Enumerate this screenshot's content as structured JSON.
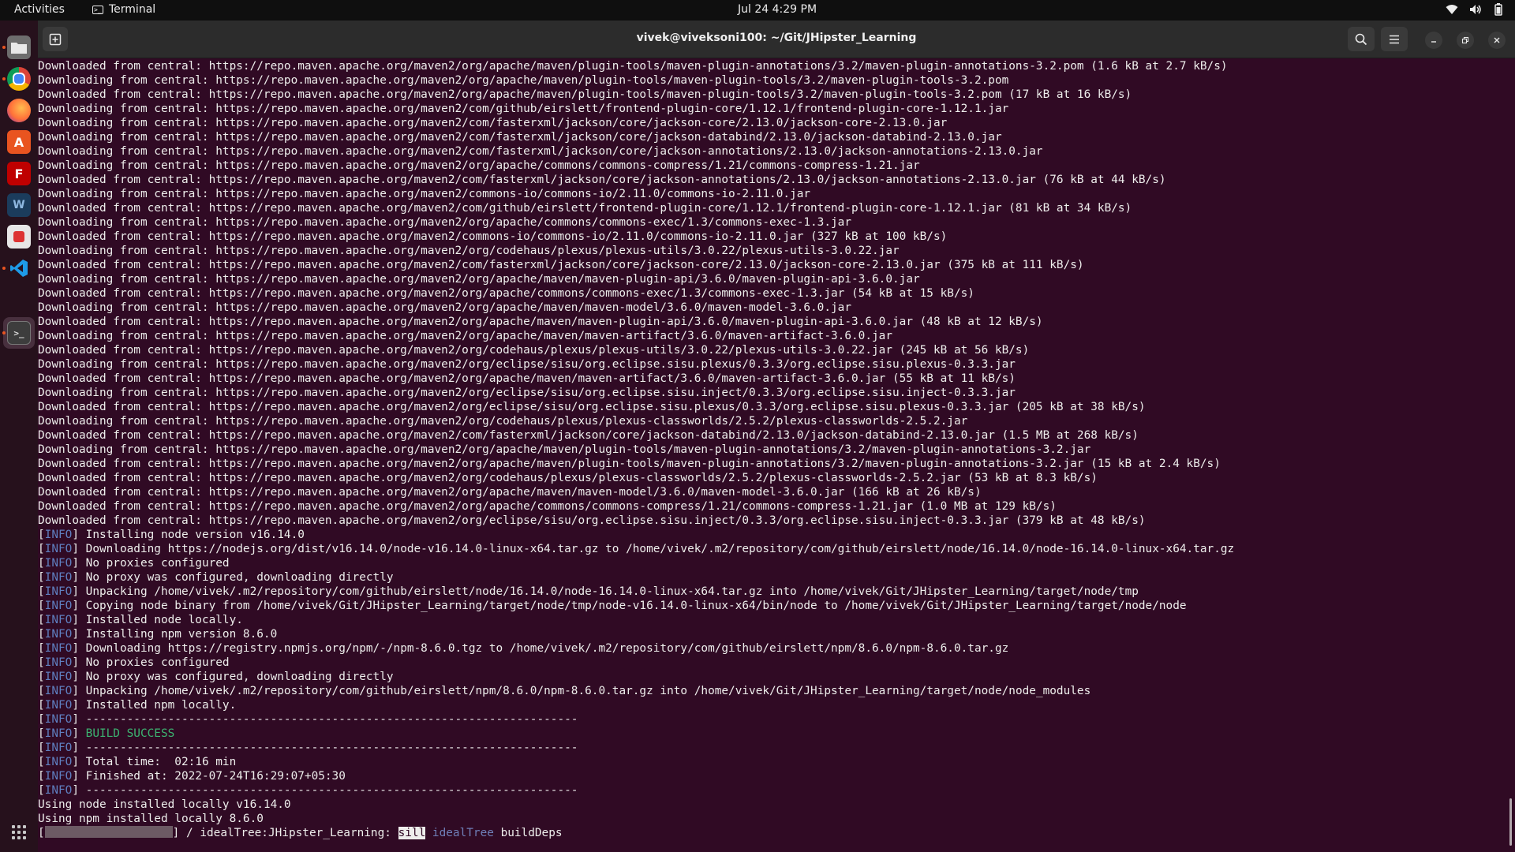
{
  "topbar": {
    "activities": "Activities",
    "app_name": "Terminal",
    "clock": "Jul 24  4:29 PM",
    "tray_icons": [
      "wifi-icon",
      "volume-icon",
      "battery-icon"
    ]
  },
  "dock": {
    "items": [
      "files-icon",
      "chrome-icon",
      "firefox-icon",
      "software-center-icon",
      "filezilla-icon",
      "mysql-workbench-icon",
      "screenshot-tool-icon",
      "vscode-icon",
      "terminal-icon"
    ],
    "show_apps": "show-applications-icon"
  },
  "window": {
    "title": "vivek@viveksoni100: ~/Git/JHipster_Learning",
    "buttons": [
      "new-tab-icon",
      "search-icon",
      "menu-icon",
      "minimize-icon",
      "maximize-icon",
      "close-icon"
    ]
  },
  "terminal": {
    "plain_lines": [
      "Downloaded from central: https://repo.maven.apache.org/maven2/org/apache/maven/plugin-tools/maven-plugin-annotations/3.2/maven-plugin-annotations-3.2.pom (1.6 kB at 2.7 kB/s)",
      "Downloading from central: https://repo.maven.apache.org/maven2/org/apache/maven/plugin-tools/maven-plugin-tools/3.2/maven-plugin-tools-3.2.pom",
      "Downloaded from central: https://repo.maven.apache.org/maven2/org/apache/maven/plugin-tools/maven-plugin-tools/3.2/maven-plugin-tools-3.2.pom (17 kB at 16 kB/s)",
      "Downloading from central: https://repo.maven.apache.org/maven2/com/github/eirslett/frontend-plugin-core/1.12.1/frontend-plugin-core-1.12.1.jar",
      "Downloading from central: https://repo.maven.apache.org/maven2/com/fasterxml/jackson/core/jackson-core/2.13.0/jackson-core-2.13.0.jar",
      "Downloading from central: https://repo.maven.apache.org/maven2/com/fasterxml/jackson/core/jackson-databind/2.13.0/jackson-databind-2.13.0.jar",
      "Downloading from central: https://repo.maven.apache.org/maven2/com/fasterxml/jackson/core/jackson-annotations/2.13.0/jackson-annotations-2.13.0.jar",
      "Downloading from central: https://repo.maven.apache.org/maven2/org/apache/commons/commons-compress/1.21/commons-compress-1.21.jar",
      "Downloaded from central: https://repo.maven.apache.org/maven2/com/fasterxml/jackson/core/jackson-annotations/2.13.0/jackson-annotations-2.13.0.jar (76 kB at 44 kB/s)",
      "Downloading from central: https://repo.maven.apache.org/maven2/commons-io/commons-io/2.11.0/commons-io-2.11.0.jar",
      "Downloaded from central: https://repo.maven.apache.org/maven2/com/github/eirslett/frontend-plugin-core/1.12.1/frontend-plugin-core-1.12.1.jar (81 kB at 34 kB/s)",
      "Downloading from central: https://repo.maven.apache.org/maven2/org/apache/commons/commons-exec/1.3/commons-exec-1.3.jar",
      "Downloaded from central: https://repo.maven.apache.org/maven2/commons-io/commons-io/2.11.0/commons-io-2.11.0.jar (327 kB at 100 kB/s)",
      "Downloading from central: https://repo.maven.apache.org/maven2/org/codehaus/plexus/plexus-utils/3.0.22/plexus-utils-3.0.22.jar",
      "Downloaded from central: https://repo.maven.apache.org/maven2/com/fasterxml/jackson/core/jackson-core/2.13.0/jackson-core-2.13.0.jar (375 kB at 111 kB/s)",
      "Downloading from central: https://repo.maven.apache.org/maven2/org/apache/maven/maven-plugin-api/3.6.0/maven-plugin-api-3.6.0.jar",
      "Downloaded from central: https://repo.maven.apache.org/maven2/org/apache/commons/commons-exec/1.3/commons-exec-1.3.jar (54 kB at 15 kB/s)",
      "Downloading from central: https://repo.maven.apache.org/maven2/org/apache/maven/maven-model/3.6.0/maven-model-3.6.0.jar",
      "Downloaded from central: https://repo.maven.apache.org/maven2/org/apache/maven/maven-plugin-api/3.6.0/maven-plugin-api-3.6.0.jar (48 kB at 12 kB/s)",
      "Downloading from central: https://repo.maven.apache.org/maven2/org/apache/maven/maven-artifact/3.6.0/maven-artifact-3.6.0.jar",
      "Downloaded from central: https://repo.maven.apache.org/maven2/org/codehaus/plexus/plexus-utils/3.0.22/plexus-utils-3.0.22.jar (245 kB at 56 kB/s)",
      "Downloading from central: https://repo.maven.apache.org/maven2/org/eclipse/sisu/org.eclipse.sisu.plexus/0.3.3/org.eclipse.sisu.plexus-0.3.3.jar",
      "Downloaded from central: https://repo.maven.apache.org/maven2/org/apache/maven/maven-artifact/3.6.0/maven-artifact-3.6.0.jar (55 kB at 11 kB/s)",
      "Downloading from central: https://repo.maven.apache.org/maven2/org/eclipse/sisu/org.eclipse.sisu.inject/0.3.3/org.eclipse.sisu.inject-0.3.3.jar",
      "Downloaded from central: https://repo.maven.apache.org/maven2/org/eclipse/sisu/org.eclipse.sisu.plexus/0.3.3/org.eclipse.sisu.plexus-0.3.3.jar (205 kB at 38 kB/s)",
      "Downloading from central: https://repo.maven.apache.org/maven2/org/codehaus/plexus/plexus-classworlds/2.5.2/plexus-classworlds-2.5.2.jar",
      "Downloaded from central: https://repo.maven.apache.org/maven2/com/fasterxml/jackson/core/jackson-databind/2.13.0/jackson-databind-2.13.0.jar (1.5 MB at 268 kB/s)",
      "Downloading from central: https://repo.maven.apache.org/maven2/org/apache/maven/plugin-tools/maven-plugin-annotations/3.2/maven-plugin-annotations-3.2.jar",
      "Downloaded from central: https://repo.maven.apache.org/maven2/org/apache/maven/plugin-tools/maven-plugin-annotations/3.2/maven-plugin-annotations-3.2.jar (15 kB at 2.4 kB/s)",
      "Downloaded from central: https://repo.maven.apache.org/maven2/org/codehaus/plexus/plexus-classworlds/2.5.2/plexus-classworlds-2.5.2.jar (53 kB at 8.3 kB/s)",
      "Downloaded from central: https://repo.maven.apache.org/maven2/org/apache/maven/maven-model/3.6.0/maven-model-3.6.0.jar (166 kB at 26 kB/s)",
      "Downloaded from central: https://repo.maven.apache.org/maven2/org/apache/commons/commons-compress/1.21/commons-compress-1.21.jar (1.0 MB at 129 kB/s)",
      "Downloaded from central: https://repo.maven.apache.org/maven2/org/eclipse/sisu/org.eclipse.sisu.inject/0.3.3/org.eclipse.sisu.inject-0.3.3.jar (379 kB at 48 kB/s)"
    ],
    "info_tag": "INFO",
    "info_lines": [
      "Installing node version v16.14.0",
      "Downloading https://nodejs.org/dist/v16.14.0/node-v16.14.0-linux-x64.tar.gz to /home/vivek/.m2/repository/com/github/eirslett/node/16.14.0/node-16.14.0-linux-x64.tar.gz",
      "No proxies configured",
      "No proxy was configured, downloading directly",
      "Unpacking /home/vivek/.m2/repository/com/github/eirslett/node/16.14.0/node-16.14.0-linux-x64.tar.gz into /home/vivek/Git/JHipster_Learning/target/node/tmp",
      "Copying node binary from /home/vivek/Git/JHipster_Learning/target/node/tmp/node-v16.14.0-linux-x64/bin/node to /home/vivek/Git/JHipster_Learning/target/node/node",
      "Installed node locally.",
      "Installing npm version 8.6.0",
      "Downloading https://registry.npmjs.org/npm/-/npm-8.6.0.tgz to /home/vivek/.m2/repository/com/github/eirslett/npm/8.6.0/npm-8.6.0.tar.gz",
      "No proxies configured",
      "No proxy was configured, downloading directly",
      "Unpacking /home/vivek/.m2/repository/com/github/eirslett/npm/8.6.0/npm-8.6.0.tar.gz into /home/vivek/Git/JHipster_Learning/target/node/node_modules",
      "Installed npm locally.",
      "------------------------------------------------------------------------",
      "BUILD SUCCESS",
      "------------------------------------------------------------------------",
      "Total time:  02:16 min",
      "Finished at: 2022-07-24T16:29:07+05:30",
      "------------------------------------------------------------------------"
    ],
    "tail_lines": [
      "Using node installed locally v16.14.0",
      "Using npm installed locally 8.6.0"
    ],
    "progress": {
      "open": "[",
      "close": "]",
      "spinner_text": " / idealTree:JHipster_Learning: ",
      "level": "sill",
      "stage": "idealTree",
      "task": " buildDeps"
    }
  }
}
